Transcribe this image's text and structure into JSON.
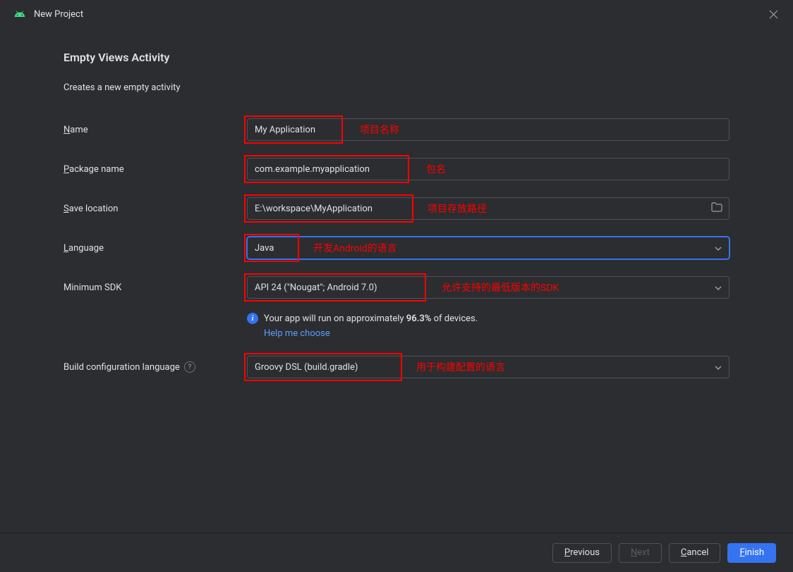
{
  "window": {
    "title": "New Project"
  },
  "page": {
    "heading": "Empty Views Activity",
    "subtitle": "Creates a new empty activity"
  },
  "form": {
    "name": {
      "label_prefix": "N",
      "label_rest": "ame",
      "value": "My Application"
    },
    "package": {
      "label_prefix": "P",
      "label_rest": "ackage name",
      "value": "com.example.myapplication"
    },
    "save": {
      "label_prefix": "S",
      "label_rest": "ave location",
      "value": "E:\\workspace\\MyApplication"
    },
    "language": {
      "label_prefix": "L",
      "label_rest": "anguage",
      "value": "Java"
    },
    "minsdk": {
      "label": "Minimum SDK",
      "value": "API 24 (\"Nougat\"; Android 7.0)"
    },
    "buildlang": {
      "label": "Build configuration language",
      "value": "Groovy DSL (build.gradle)"
    }
  },
  "info": {
    "text_before": "Your app will run on approximately ",
    "percent": "96.3%",
    "text_after": " of devices.",
    "help_link": "Help me choose"
  },
  "annotations": {
    "name": "项目名称",
    "package": "包名",
    "save": "项目存放路径",
    "language": "开发Android的语言",
    "minsdk": "允许支持的最低版本的SDK",
    "buildlang": "用于构建配置的语言"
  },
  "footer": {
    "previous_prefix": "P",
    "previous_rest": "revious",
    "next_prefix": "N",
    "next_rest": "ext",
    "cancel_prefix": "C",
    "cancel_rest": "ancel",
    "finish_prefix": "F",
    "finish_rest": "inish"
  }
}
